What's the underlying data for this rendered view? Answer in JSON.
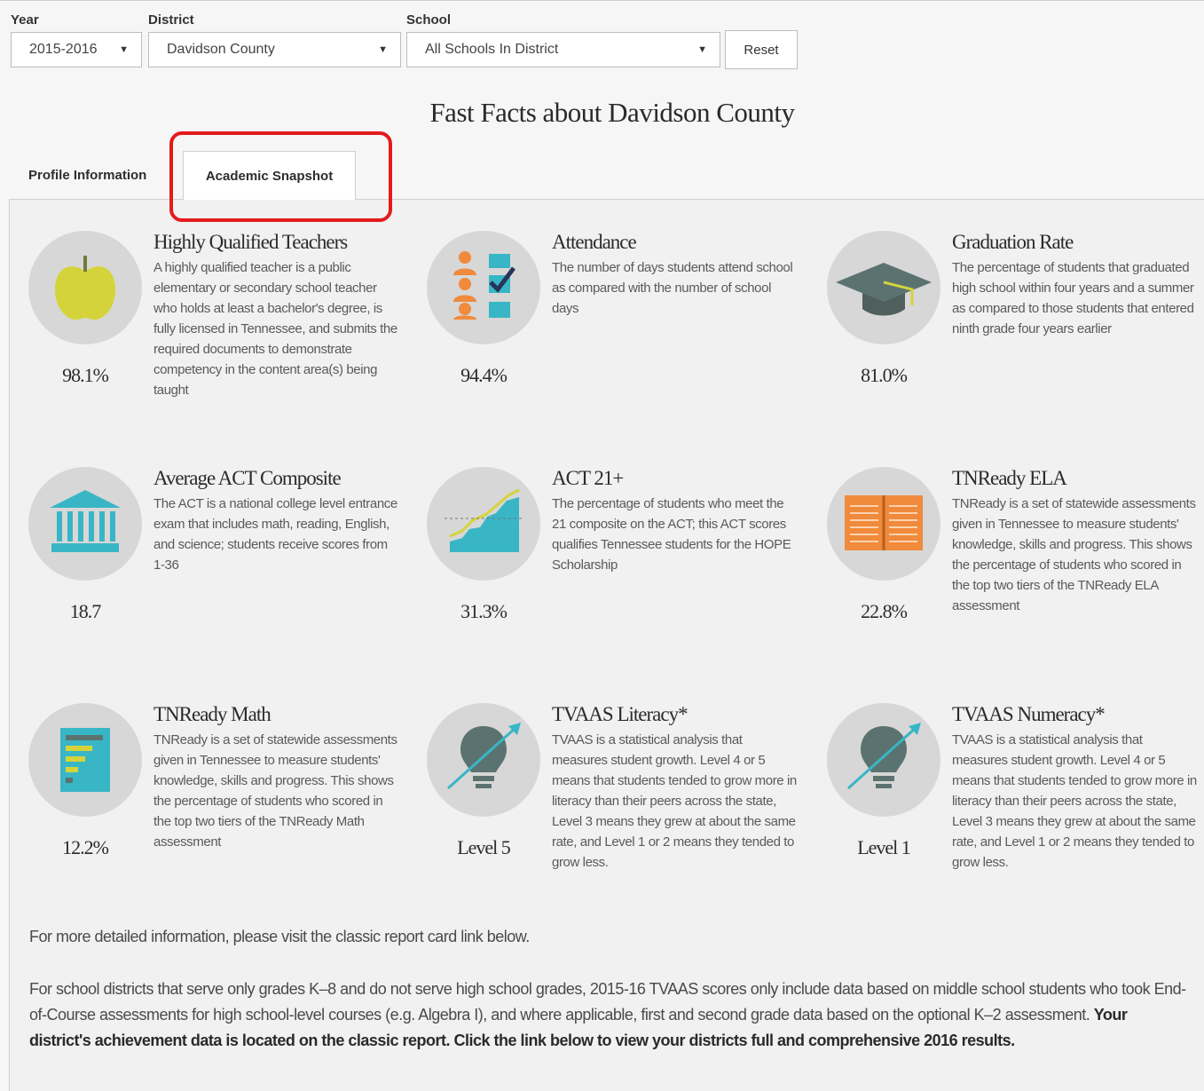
{
  "filters": {
    "year": {
      "label": "Year",
      "value": "2015-2016"
    },
    "district": {
      "label": "District",
      "value": "Davidson County"
    },
    "school": {
      "label": "School",
      "value": "All Schools In District"
    },
    "reset_label": "Reset"
  },
  "page_title": "Fast Facts about Davidson County",
  "tabs": [
    {
      "label": "Profile Information",
      "active": false
    },
    {
      "label": "Academic Snapshot",
      "active": true
    }
  ],
  "cards": [
    {
      "icon": "apple-icon",
      "title": "Highly Qualified Teachers",
      "value": "98.1%",
      "desc": "A highly qualified teacher is a public elementary or secondary school teacher who holds at least a bachelor's degree, is fully licensed in Tennessee, and submits the required documents to demonstrate competency in the content area(s) being taught"
    },
    {
      "icon": "attendance-checklist-icon",
      "title": "Attendance",
      "value": "94.4%",
      "desc": "The number of days students attend school as compared with the number of school days"
    },
    {
      "icon": "graduation-cap-icon",
      "title": "Graduation Rate",
      "value": "81.0%",
      "desc": "The percentage of students that graduated high school within four years and a summer as compared to those students that entered ninth grade four years earlier"
    },
    {
      "icon": "college-building-icon",
      "title": "Average ACT Composite",
      "value": "18.7",
      "desc": "The ACT is a national college level entrance exam that includes math, reading, English, and science; students receive scores from 1-36"
    },
    {
      "icon": "growth-chart-icon",
      "title": "ACT 21+",
      "value": "31.3%",
      "desc": "The percentage of students who meet the 21 composite on the ACT; this ACT scores qualifies Tennessee students for the HOPE Scholarship"
    },
    {
      "icon": "open-book-icon",
      "title": "TNReady ELA",
      "value": "22.8%",
      "desc": "TNReady is a set of statewide assessments given in Tennessee to measure students' knowledge, skills and progress. This shows the percentage of students who scored in the top two tiers of the TNReady ELA assessment"
    },
    {
      "icon": "math-worksheet-icon",
      "title": "TNReady Math",
      "value": "12.2%",
      "desc": "TNReady is a set of statewide assessments given in Tennessee to measure students' knowledge, skills and progress. This shows the percentage of students who scored in the top two tiers of the TNReady Math assessment"
    },
    {
      "icon": "lightbulb-growth-icon",
      "title": "TVAAS Literacy*",
      "value": "Level 5",
      "desc": "TVAAS is a statistical analysis that measures student growth.  Level 4 or 5 means that students tended to grow more in literacy than their peers across the state, Level 3 means they grew at about the same rate, and Level 1 or 2 means they tended to grow less."
    },
    {
      "icon": "lightbulb-growth-icon",
      "title": "TVAAS Numeracy*",
      "value": "Level 1",
      "desc": "TVAAS is a statistical analysis that measures student growth.  Level 4 or 5 means that students tended to grow more in literacy than their peers across the state, Level 3 means they grew at about the same rate, and Level 1 or 2 means they tended to grow less."
    }
  ],
  "footer": {
    "line1": "For more detailed information, please visit the classic report card link below.",
    "line2_plain": "For school districts that serve only grades K–8 and do not serve high school grades, 2015-16 TVAAS scores only include data based on middle school students who took End-of-Course assessments for high school-level courses (e.g. Algebra I), and where applicable, first and second grade data based on the optional K–2 assessment. ",
    "line2_bold": "Your district's achievement data is located on the classic report. Click the link below to view your districts full and comprehensive 2016 results."
  },
  "colors": {
    "highlight": "#e31b1b",
    "apple": "#d4d43a",
    "slate": "#5b7370",
    "teal": "#38b6c6",
    "orange": "#f08a3c"
  }
}
